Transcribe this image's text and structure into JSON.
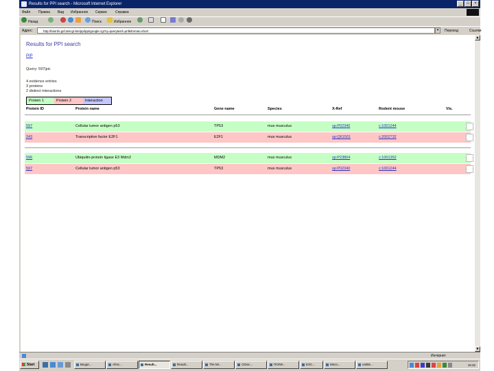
{
  "window": {
    "title": "Results for PPI search - Microsoft Internet Explorer",
    "min": "_",
    "max": "□",
    "close": "×"
  },
  "menu": [
    "Файл",
    "Правка",
    "Вид",
    "Избранное",
    "Сервис",
    "Справка"
  ],
  "toolbar": {
    "back": "Назад",
    "search": "Поиск",
    "favorites": "Избранное"
  },
  "address": {
    "label": "Адрес:",
    "url": "http://bioinfo.gsf.de/cgi-bin/ppi/ppi/google.cgi?q=query&ref=pnf&format=short",
    "go": "Переход",
    "links": "Ссылки"
  },
  "page": {
    "title": "Results for PPI search",
    "link": "PIP",
    "query": "Query: 597|pic",
    "summary": [
      "4 evidence entries",
      "3 proteins",
      "2 distinct interactions"
    ],
    "legend": {
      "protein1": "Protein 1",
      "protein2": "Protein 2",
      "interaction": "Interaction"
    },
    "columns": {
      "protein_id": "Protein ID",
      "protein_name": "Protein name",
      "gene_name": "Gene name",
      "species": "Species",
      "xref": "X-Ref",
      "rodent": "Rodent mouse",
      "vis": "Vis."
    },
    "groups": [
      {
        "rows": [
          {
            "id": "597",
            "name": "Cellular tumor antigen p53",
            "gene": "TP53",
            "species": "mus musculus",
            "xref": "sp:P02340",
            "rodent": "c:1001244",
            "role": "protein1"
          },
          {
            "id": "243",
            "name": "Transcription factor E2F1",
            "gene": "E2F1",
            "species": "mus musculus",
            "xref": "sp:Q61501",
            "rodent": "c:2002732",
            "role": "protein2"
          }
        ]
      },
      {
        "rows": [
          {
            "id": "596",
            "name": "Ubiquitin-protein ligase E3 Mdm2",
            "gene": "MDM2",
            "species": "mus musculus",
            "xref": "sp:P23804",
            "rodent": "c:1001352",
            "role": "protein1"
          },
          {
            "id": "597",
            "name": "Cellular tumor antigen p53",
            "gene": "TP53",
            "species": "mus musculus",
            "xref": "sp:P02340",
            "rodent": "c:1001244",
            "role": "protein2"
          }
        ]
      }
    ]
  },
  "status": {
    "zone": "Интернет"
  },
  "taskbar": {
    "start": "Start",
    "tasks": [
      "Входя...",
      "Аhnc...",
      "Result...",
      "Result...",
      "The Mi...",
      "CtDoc...",
      "ПОЛИ...",
      "EXC...",
      "Micro...",
      "untitle..."
    ],
    "active_index": 2,
    "clock": "16:32"
  },
  "colors": {
    "protein1": "#c6ffc6",
    "protein2": "#ffc6c6",
    "interaction": "#c6c6ff",
    "title": "#3a3aa0",
    "link": "#2030c0"
  }
}
